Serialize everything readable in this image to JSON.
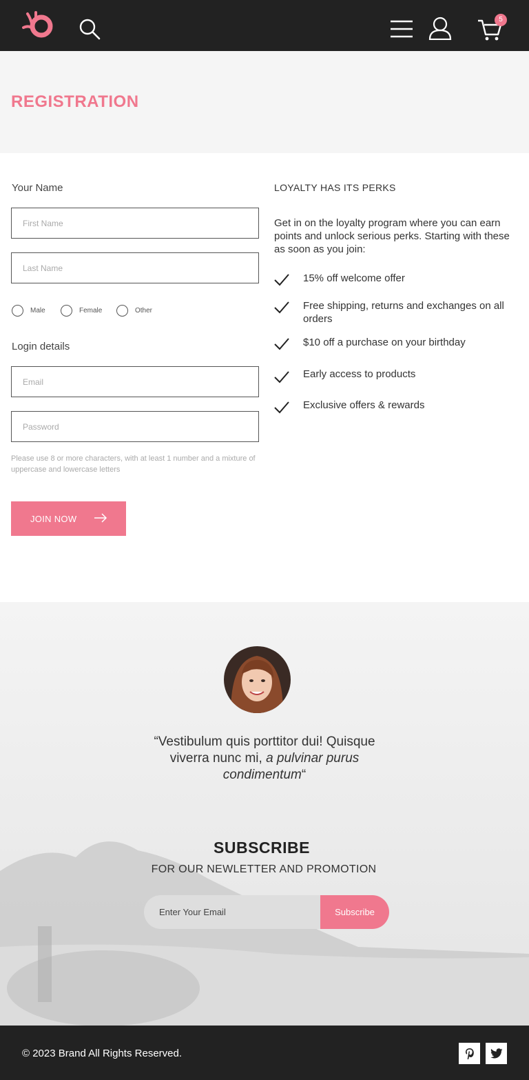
{
  "header": {
    "cart_count": "5",
    "icons": [
      "brand-logo",
      "search-icon",
      "hamburger-menu-icon",
      "user-icon",
      "cart-icon"
    ]
  },
  "page": {
    "title": "REGISTRATION"
  },
  "form": {
    "name_label": "Your Name",
    "first_name_placeholder": "First Name",
    "last_name_placeholder": "Last Name",
    "gender_options": [
      "Male",
      "Female",
      "Other"
    ],
    "login_label": "Login details",
    "email_placeholder": "Email",
    "password_placeholder": "Password",
    "password_hint": "Please use 8 or more characters, with at least 1 number and a mixture of uppercase and lowercase letters",
    "submit_label": "JOIN NOW"
  },
  "perks": {
    "title": "LOYALTY HAS ITS PERKS",
    "intro": "Get in on the loyalty program where you can earn points and unlock serious perks. Starting with these as soon as you join:",
    "items": [
      "15% off welcome offer",
      "Free shipping, returns and exchanges on all orders",
      "$10 off a purchase on your birthday",
      "Early access to products",
      "Exclusive offers & rewards"
    ]
  },
  "testimonial": {
    "quote_open": "“Vestibulum quis porttitor dui! Quisque viverra nunc mi, ",
    "quote_emphasis": "a pulvinar purus condimentum",
    "quote_close": "“"
  },
  "subscribe": {
    "title": "SUBSCRIBE",
    "subtitle": "FOR OUR NEWLETTER AND PROMOTION",
    "email_placeholder": "Enter Your Email",
    "button_label": "Subscribe"
  },
  "footer": {
    "copyright": "© 2023  Brand  All Rights Reserved.",
    "social": [
      "pinterest-icon",
      "twitter-icon"
    ]
  },
  "colors": {
    "accent": "#f0788e",
    "dark": "#222222",
    "band": "#f5f5f5"
  }
}
